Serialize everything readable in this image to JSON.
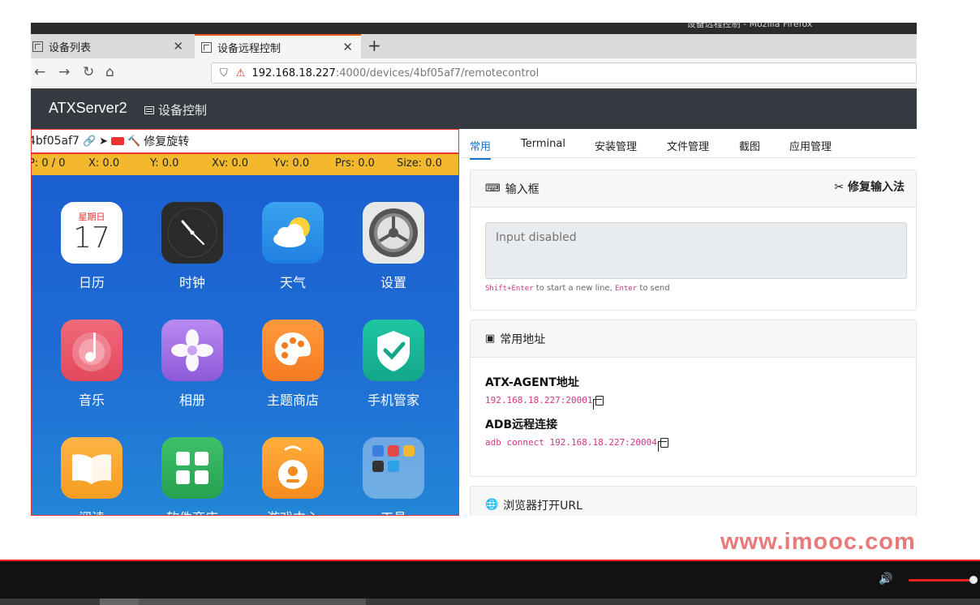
{
  "window": {
    "title": "设备远程控制 - Mozilla Firefox"
  },
  "browser": {
    "tabs": [
      {
        "label": "设备列表"
      },
      {
        "label": "设备远程控制"
      }
    ],
    "url_host": "192.168.18.227",
    "url_path": ":4000/devices/4bf05af7/remotecontrol"
  },
  "app": {
    "brand": "ATXServer2",
    "nav_link": "设备控制"
  },
  "device": {
    "id_label": "4bf05af7",
    "fix_rotation": "修复旋转",
    "stats": {
      "pointers": "P: 0 / 0",
      "x": "X: 0.0",
      "y": "Y: 0.0",
      "xv": "Xv: 0.0",
      "yv": "Yv: 0.0",
      "prs": "Prs: 0.0",
      "size": "Size: 0.0"
    },
    "apps": [
      {
        "label": "日历",
        "icon": "calendar-icon",
        "weekday": "星期日",
        "day": "17"
      },
      {
        "label": "时钟",
        "icon": "clock-icon"
      },
      {
        "label": "天气",
        "icon": "weather-icon"
      },
      {
        "label": "设置",
        "icon": "settings-icon"
      },
      {
        "label": "音乐",
        "icon": "music-icon"
      },
      {
        "label": "相册",
        "icon": "gallery-icon"
      },
      {
        "label": "主题商店",
        "icon": "theme-store-icon"
      },
      {
        "label": "手机管家",
        "icon": "phone-manager-icon"
      },
      {
        "label": "阅读",
        "icon": "book-icon"
      },
      {
        "label": "软件商店",
        "icon": "app-store-icon"
      },
      {
        "label": "游戏中心",
        "icon": "game-center-icon"
      },
      {
        "label": "工具",
        "icon": "tools-folder-icon"
      }
    ]
  },
  "panel": {
    "tabs": [
      "常用",
      "Terminal",
      "安装管理",
      "文件管理",
      "截图",
      "应用管理"
    ],
    "input_card": {
      "title": "输入框",
      "fix_ime": "修复输入法",
      "placeholder": "Input disabled",
      "hint_key1": "Shift+Enter",
      "hint_text1": " to start a new line, ",
      "hint_key2": "Enter",
      "hint_text2": " to send"
    },
    "address_card": {
      "title": "常用地址",
      "agent_label": "ATX-AGENT地址",
      "agent_value": "192.168.18.227:20001",
      "adb_label": "ADB远程连接",
      "adb_value": "adb connect 192.168.18.227:20004"
    },
    "browser_card": {
      "title": "浏览器打开URL"
    }
  },
  "watermark": "www.imooc.com",
  "colors": {
    "navbar_bg": "#343a40",
    "status_bar": "#f2b92f",
    "active_tab": "#1a73c9",
    "code_pink": "#d63384",
    "accent_red": "#e22222"
  }
}
